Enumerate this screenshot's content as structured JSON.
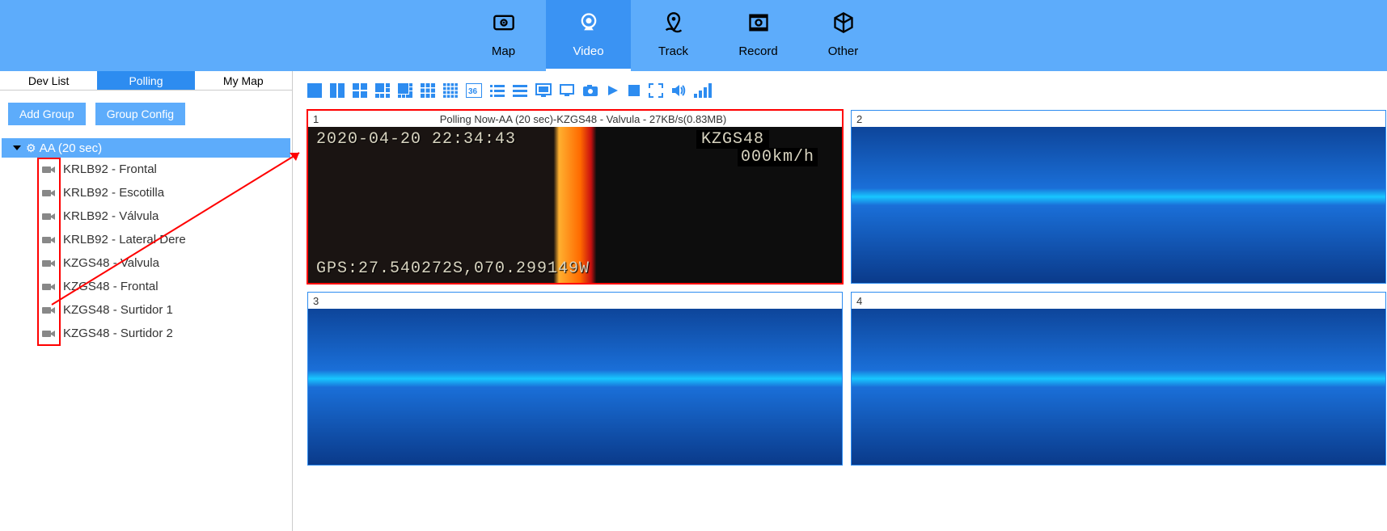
{
  "nav": {
    "map": "Map",
    "video": "Video",
    "track": "Track",
    "record": "Record",
    "other": "Other"
  },
  "sidebar": {
    "tabs": {
      "devlist": "Dev List",
      "polling": "Polling",
      "mymap": "My Map"
    },
    "buttons": {
      "add_group": "Add Group",
      "group_config": "Group Config"
    },
    "group": {
      "name": "AA (20 sec)"
    },
    "cams": [
      "KRLB92 - Frontal",
      "KRLB92 - Escotilla",
      "KRLB92 - Válvula",
      "KRLB92 - Lateral Dere",
      "KZGS48 - Valvula",
      "KZGS48 - Frontal",
      "KZGS48 - Surtidor 1",
      "KZGS48 - Surtidor 2"
    ]
  },
  "tiles": {
    "t1": {
      "num": "1",
      "title": "Polling Now-AA (20 sec)-KZGS48 - Valvula - 27KB/s(0.83MB)",
      "osd_time": "2020-04-20 22:34:43",
      "osd_id": "KZGS48",
      "osd_speed": "000km/h",
      "osd_gps": "GPS:27.540272S,070.299149W"
    },
    "t2": {
      "num": "2"
    },
    "t3": {
      "num": "3"
    },
    "t4": {
      "num": "4"
    }
  }
}
